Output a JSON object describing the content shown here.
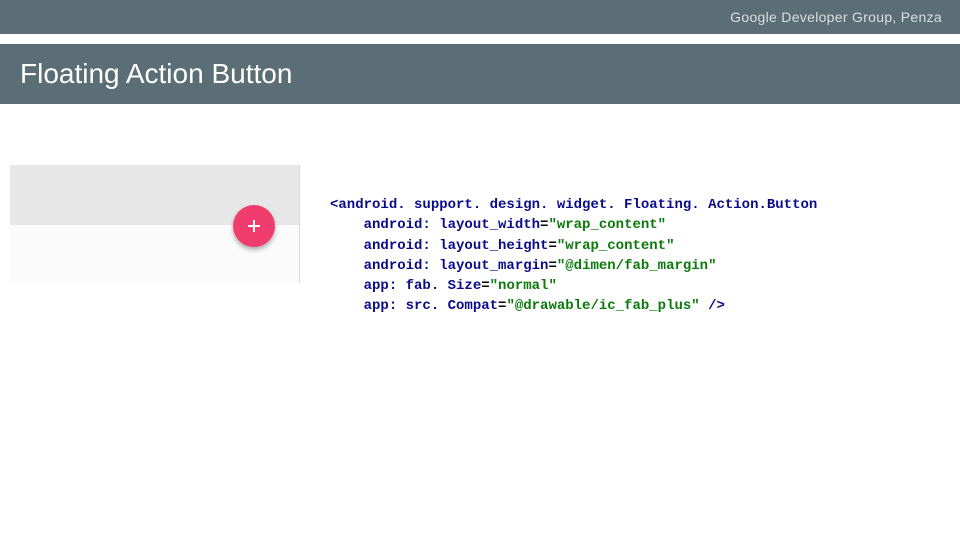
{
  "header": {
    "group_label": "Google Developer Group, Penza"
  },
  "title_band": {
    "title": "Floating Action Button"
  },
  "preview": {
    "fab_icon_name": "plus"
  },
  "code": {
    "open_bracket": "<",
    "tag": "android. support. design. widget. Floating. Action.Button",
    "indent": "    ",
    "attrs": [
      {
        "name": "android: layout_width",
        "value": "\"wrap_content\""
      },
      {
        "name": "android: layout_height",
        "value": "\"wrap_content\""
      },
      {
        "name": "android: layout_margin",
        "value": "\"@dimen/fab_margin\""
      },
      {
        "name": "app: fab. Size",
        "value": "\"normal\""
      },
      {
        "name": "app: src. Compat",
        "value": "\"@drawable/ic_fab_plus\""
      }
    ],
    "close": " />"
  }
}
